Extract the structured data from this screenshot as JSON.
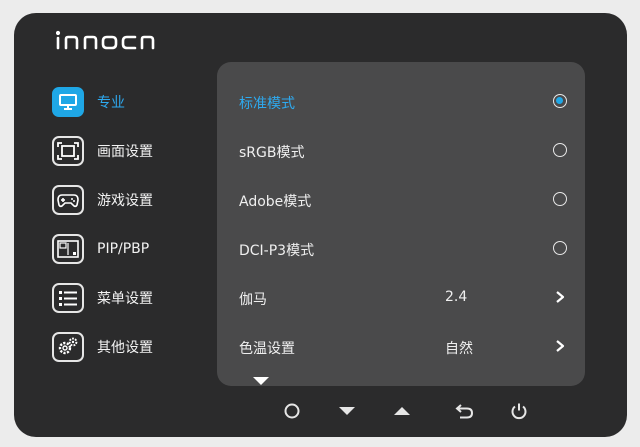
{
  "brand": {
    "logo_text": "INNOCN"
  },
  "sidebar": {
    "items": [
      {
        "label": "专业",
        "icon": "monitor-icon",
        "active": true
      },
      {
        "label": "画面设置",
        "icon": "screen-fit-icon",
        "active": false
      },
      {
        "label": "游戏设置",
        "icon": "gamepad-icon",
        "active": false
      },
      {
        "label": "PIP/PBP",
        "icon": "pip-icon",
        "active": false
      },
      {
        "label": "菜单设置",
        "icon": "menu-list-icon",
        "active": false
      },
      {
        "label": "其他设置",
        "icon": "gears-icon",
        "active": false
      }
    ]
  },
  "panel": {
    "rows": [
      {
        "label": "标准模式",
        "control": "radio",
        "checked": true
      },
      {
        "label": "sRGB模式",
        "control": "radio",
        "checked": false
      },
      {
        "label": "Adobe模式",
        "control": "radio",
        "checked": false
      },
      {
        "label": "DCI-P3模式",
        "control": "radio",
        "checked": false
      },
      {
        "label": "伽马",
        "value": "2.4",
        "control": "chevron"
      },
      {
        "label": "色温设置",
        "value": "自然",
        "control": "chevron"
      }
    ],
    "more_indicator": "triangle-down-icon"
  },
  "controls": [
    "power-circle-icon",
    "arrow-down-icon",
    "arrow-up-icon",
    "back-icon",
    "power-icon"
  ],
  "colors": {
    "accent": "#1fa7e6",
    "panel_bg": "#4a4a4b",
    "osd_bg": "#2b2b2c"
  }
}
